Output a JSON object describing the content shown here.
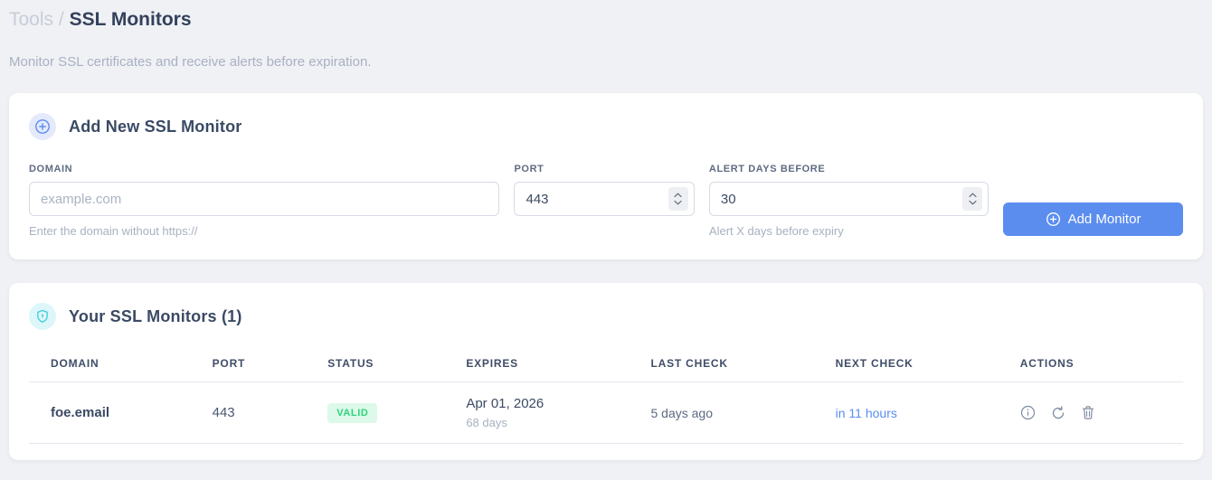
{
  "page": {
    "breadcrumb": {
      "parent": "Tools",
      "separator": "/",
      "current": "SSL Monitors"
    },
    "subtitle": "Monitor SSL certificates and receive alerts before expiration."
  },
  "add_monitor": {
    "title": "Add New SSL Monitor",
    "fields": {
      "domain": {
        "label": "DOMAIN",
        "placeholder": "example.com",
        "hint": "Enter the domain without https://"
      },
      "port": {
        "label": "PORT",
        "value": "443"
      },
      "alert_days": {
        "label": "ALERT DAYS BEFORE",
        "value": "30",
        "hint": "Alert X days before expiry"
      }
    },
    "submit_label": "Add Monitor"
  },
  "monitors": {
    "title": "Your SSL Monitors (1)",
    "columns": [
      "DOMAIN",
      "PORT",
      "STATUS",
      "EXPIRES",
      "LAST CHECK",
      "NEXT CHECK",
      "ACTIONS"
    ],
    "rows": [
      {
        "domain": "foe.email",
        "port": "443",
        "status": "VALID",
        "expires_date": "Apr 01, 2026",
        "expires_days": "68 days",
        "last_check": "5 days ago",
        "next_check": "in 11 hours"
      }
    ]
  },
  "colors": {
    "accent_blue": "#5b8def",
    "accent_cyan": "#3ecfda",
    "status_valid_bg": "#dcf9ea",
    "status_valid_text": "#2ed47a",
    "page_bg": "#f0f1f5"
  }
}
